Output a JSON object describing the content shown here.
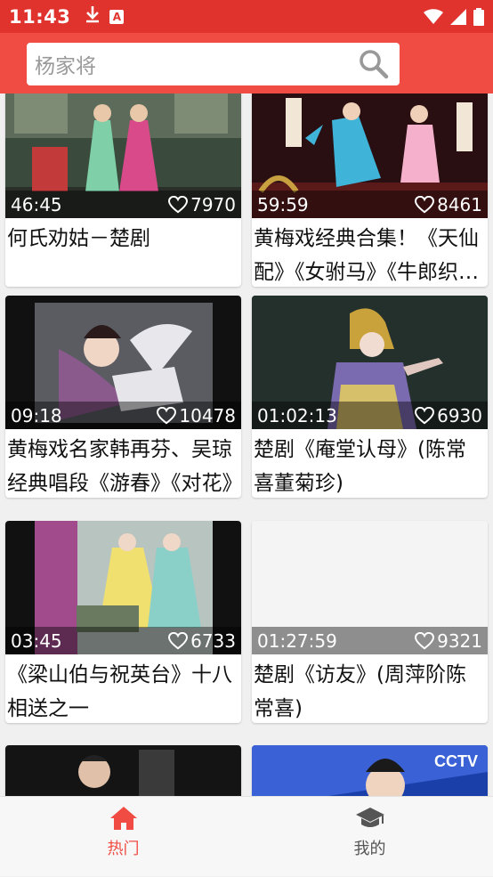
{
  "status_bar": {
    "time": "11:43"
  },
  "search": {
    "placeholder": "杨家将"
  },
  "videos": [
    {
      "duration": "46:45",
      "likes": "7970",
      "title": "何氏劝姑－楚剧"
    },
    {
      "duration": "59:59",
      "likes": "8461",
      "title": "黄梅戏经典合集！《天仙配》《女驸马》《牛郎织女》"
    },
    {
      "duration": "09:18",
      "likes": "10478",
      "title": "黄梅戏名家韩再芬、吴琼经典唱段《游春》《对花》"
    },
    {
      "duration": "01:02:13",
      "likes": "6930",
      "title": "楚剧《庵堂认母》(陈常喜董菊珍)"
    },
    {
      "duration": "03:45",
      "likes": "6733",
      "title": "《梁山伯与祝英台》十八相送之一"
    },
    {
      "duration": "01:27:59",
      "likes": "9321",
      "title": "楚剧《访友》(周萍阶陈常喜)"
    }
  ],
  "nav": {
    "hot": "热门",
    "mine": "我的"
  },
  "colors": {
    "primary": "#f14c43",
    "status_bar": "#e0332e"
  }
}
